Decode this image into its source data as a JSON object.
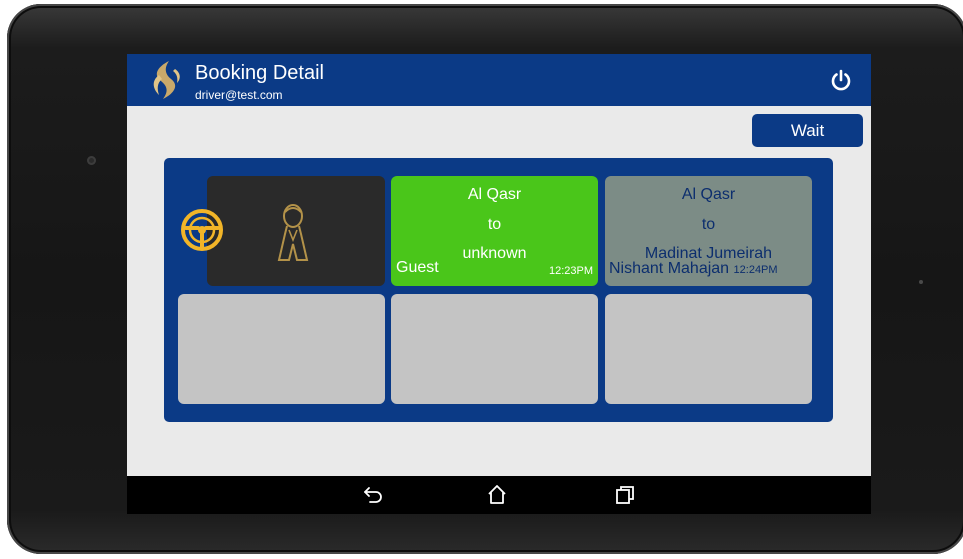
{
  "appbar": {
    "title": "Booking Detail",
    "subtitle": "driver@test.com",
    "logo_icon": "company-logo",
    "power_icon": "power-icon"
  },
  "actions": {
    "wait_label": "Wait"
  },
  "bookings": [
    {
      "from": "Al Qasr",
      "connector": "to",
      "to": "unknown",
      "passenger": "Guest",
      "time": "12:23PM"
    },
    {
      "from": "Al Qasr",
      "connector": "to",
      "to": "Madinat Jumeirah",
      "passenger": "Nishant Mahajan",
      "time": "12:24PM"
    }
  ],
  "driver_cell": {
    "icons": [
      "steering-wheel-icon",
      "driver-icon"
    ]
  },
  "navbar": {
    "icons": [
      "back-icon",
      "home-icon",
      "recent-apps-icon"
    ]
  },
  "colors": {
    "primary": "#0b3a86",
    "active_booking": "#4ac61a",
    "pending_booking": "#7c8c86",
    "empty_slot": "#c4c4c4",
    "accent_gold": "#d9a42c"
  }
}
